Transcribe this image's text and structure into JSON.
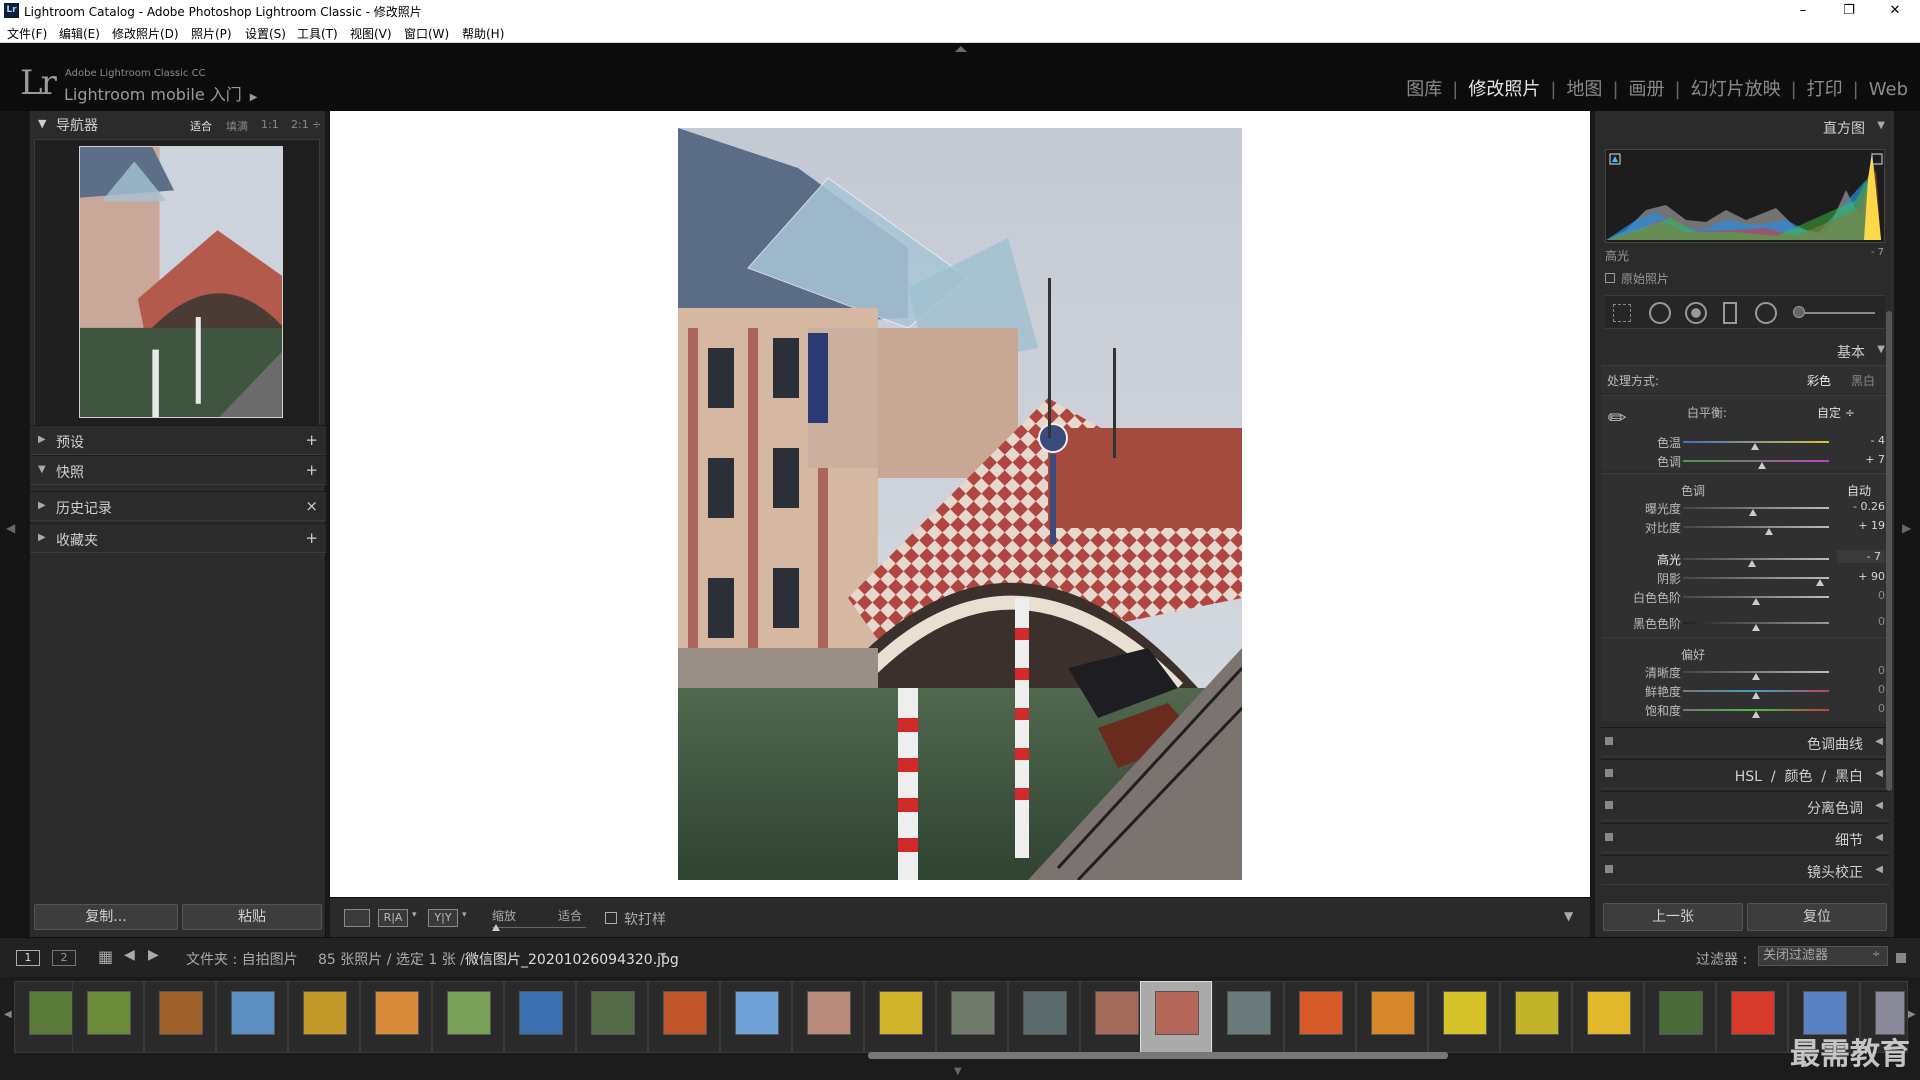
{
  "window": {
    "title": "Lightroom Catalog - Adobe Photoshop Lightroom Classic - 修改照片",
    "app_badge": "Lr"
  },
  "window_controls": {
    "minimize": "–",
    "restore": "❐",
    "close": "✕"
  },
  "menu": [
    "文件(F)",
    "编辑(E)",
    "修改照片(D)",
    "照片(P)",
    "设置(S)",
    "工具(T)",
    "视图(V)",
    "窗口(W)",
    "帮助(H)"
  ],
  "identity": {
    "logo": "Lr",
    "product": "Adobe Lightroom Classic CC",
    "mobile": "Lightroom mobile 入门",
    "arrow": "▶"
  },
  "modules": [
    {
      "label": "图库",
      "active": false
    },
    {
      "label": "修改照片",
      "active": true
    },
    {
      "label": "地图",
      "active": false
    },
    {
      "label": "画册",
      "active": false
    },
    {
      "label": "幻灯片放映",
      "active": false
    },
    {
      "label": "打印",
      "active": false
    },
    {
      "label": "Web",
      "active": false
    }
  ],
  "left": {
    "navigator": {
      "title": "导航器",
      "zoom": [
        "适合",
        "填满",
        "1:1",
        "2:1"
      ],
      "zoom_more": "÷"
    },
    "panels": [
      {
        "label": "预设",
        "twisty": "▶",
        "action": "+"
      },
      {
        "label": "快照",
        "twisty": "▼",
        "action": "+"
      },
      {
        "label": "历史记录",
        "twisty": "▶",
        "action": "×"
      },
      {
        "label": "收藏夹",
        "twisty": "▶",
        "action": "+"
      }
    ],
    "copy_btn": "复制...",
    "paste_btn": "粘贴"
  },
  "toolbar": {
    "zoom_label": "缩放",
    "zoom_value": "适合",
    "softproof": "软打样",
    "ra": "R|A",
    "yy": "Y|Y"
  },
  "right": {
    "histogram": {
      "title": "直方图",
      "channel": "高光",
      "value": "- 7",
      "original": "原始照片"
    },
    "basic": {
      "title": "基本",
      "treatment_label": "处理方式:",
      "color": "彩色",
      "bw": "黑白",
      "wb_label": "白平衡:",
      "wb_value": "自定 ÷",
      "tone_label": "色调",
      "auto": "自动",
      "presence_label": "偏好",
      "sliders": [
        {
          "label": "色温",
          "value": "- 4",
          "pos": 0.49
        },
        {
          "label": "色调",
          "value": "+ 7",
          "pos": 0.54
        },
        {
          "label": "曝光度",
          "value": "- 0.26",
          "pos": 0.48
        },
        {
          "label": "对比度",
          "value": "+ 19",
          "pos": 0.59
        },
        {
          "label": "高光",
          "value": "- 7",
          "pos": 0.47
        },
        {
          "label": "阴影",
          "value": "+ 90",
          "pos": 0.94
        },
        {
          "label": "白色色阶",
          "value": "0",
          "pos": 0.5
        },
        {
          "label": "黑色色阶",
          "value": "0",
          "pos": 0.5
        },
        {
          "label": "清晰度",
          "value": "0",
          "pos": 0.5
        },
        {
          "label": "鲜艳度",
          "value": "0",
          "pos": 0.5
        },
        {
          "label": "饱和度",
          "value": "0",
          "pos": 0.5
        }
      ]
    },
    "collapsed": [
      {
        "label": "色调曲线"
      },
      {
        "label": "HSL  /  颜色  /  黑白"
      },
      {
        "label": "分离色调"
      },
      {
        "label": "细节"
      },
      {
        "label": "镜头校正"
      }
    ],
    "prev_btn": "上一张",
    "reset_btn": "复位"
  },
  "filmbar": {
    "page1": "1",
    "page2": "2",
    "source_prefix": "文件夹 : 自拍图片",
    "count": "85 张照片 / 选定 1 张 /",
    "filename": "微信图片_20201026094320.jpg",
    "filename_arrow": "▾",
    "filter_label": "过滤器 :",
    "filter_value": "关闭过滤器"
  },
  "watermark": "最需教育",
  "colors": {
    "accent": "#e6e6e6",
    "panel": "#2b2b2b",
    "dark": "#1a1a1a"
  }
}
